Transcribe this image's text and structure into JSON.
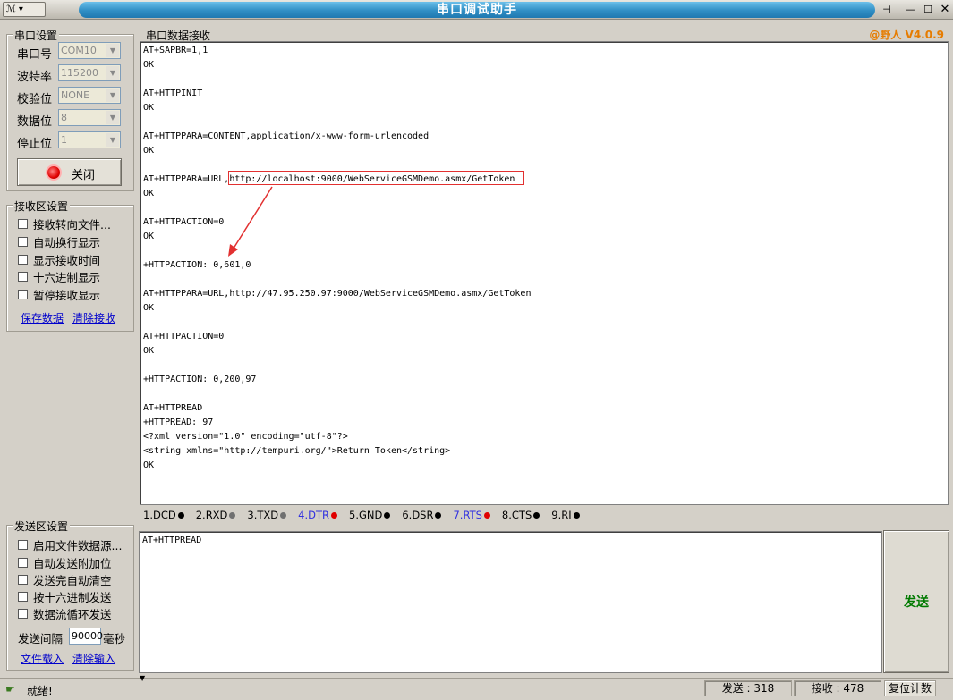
{
  "title": "串口调试助手",
  "version": "@野人 V4.0.9",
  "colors": {
    "title_bar": "#2f8ec4",
    "version": "#e67c00",
    "send_button": "#007a00",
    "rts": "#3030e0"
  },
  "port_settings": {
    "group_title": "串口设置",
    "fields": [
      {
        "label": "串口号",
        "value": "COM10"
      },
      {
        "label": "波特率",
        "value": "115200"
      },
      {
        "label": "校验位",
        "value": "NONE"
      },
      {
        "label": "数据位",
        "value": "8"
      },
      {
        "label": "停止位",
        "value": "1"
      }
    ],
    "close_label": "关闭"
  },
  "receive_settings": {
    "group_title": "接收区设置",
    "options": [
      "接收转向文件...",
      "自动换行显示",
      "显示接收时间",
      "十六进制显示",
      "暂停接收显示"
    ],
    "save_label": "保存数据",
    "clear_label": "清除接收"
  },
  "send_settings": {
    "group_title": "发送区设置",
    "options": [
      "启用文件数据源...",
      "自动发送附加位",
      "发送完自动清空",
      "按十六进制发送",
      "数据流循环发送"
    ],
    "interval_label": "发送间隔",
    "interval_value": "90000",
    "interval_unit": "毫秒",
    "load_label": "文件载入",
    "clear_label": "清除输入"
  },
  "receive_area": {
    "group_title": "串口数据接收",
    "lines": [
      "AT+SAPBR=1,1",
      "OK",
      "",
      "AT+HTTPINIT",
      "OK",
      "",
      "AT+HTTPPARA=CONTENT,application/x-www-form-urlencoded",
      "OK",
      "",
      "AT+HTTPPARA=URL,http://localhost:9000/WebServiceGSMDemo.asmx/GetToken",
      "OK",
      "",
      "AT+HTTPACTION=0",
      "OK",
      "",
      "+HTTPACTION: 0,601,0",
      "",
      "AT+HTTPPARA=URL,http://47.95.250.97:9000/WebServiceGSMDemo.asmx/GetToken",
      "OK",
      "",
      "AT+HTTPACTION=0",
      "OK",
      "",
      "+HTTPACTION: 0,200,97",
      "",
      "AT+HTTPREAD",
      "+HTTPREAD: 97",
      "<?xml version=\"1.0\" encoding=\"utf-8\"?>",
      "<string xmlns=\"http://tempuri.org/\">Return Token</string>",
      "OK"
    ]
  },
  "signals": [
    {
      "name": "1.DCD",
      "color": "#000000"
    },
    {
      "name": "2.RXD",
      "color": "#707070"
    },
    {
      "name": "3.TXD",
      "color": "#707070"
    },
    {
      "name": "4.DTR",
      "color": "#e00000",
      "label_color": "#3030e0"
    },
    {
      "name": "5.GND",
      "color": "#000000"
    },
    {
      "name": "6.DSR",
      "color": "#000000"
    },
    {
      "name": "7.RTS",
      "color": "#e00000",
      "label_color": "#3030e0"
    },
    {
      "name": "8.CTS",
      "color": "#000000"
    },
    {
      "name": "9.RI",
      "color": "#000000"
    }
  ],
  "send_area": {
    "text": "AT+HTTPREAD",
    "send_label": "发送"
  },
  "status": {
    "ready": "就绪!",
    "sent": "发送 : 318",
    "received": "接收 : 478",
    "reset_label": "复位计数"
  }
}
